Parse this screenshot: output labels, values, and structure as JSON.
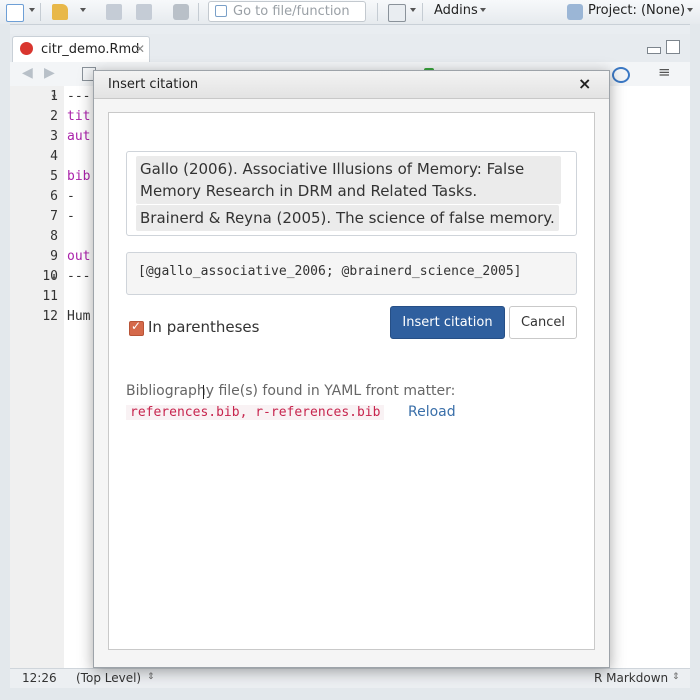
{
  "toolbar": {
    "goto_placeholder": "Go to file/function",
    "addins_label": "Addins",
    "project_label": "Project: (None)"
  },
  "editor": {
    "tab_label": "citr_demo.Rmd",
    "line_numbers": [
      "1",
      "2",
      "3",
      "4",
      "5",
      "6",
      "7",
      "8",
      "9",
      "10",
      "11",
      "12"
    ],
    "code_lines": [
      {
        "text": "---",
        "color": "#333333"
      },
      {
        "text": "tit",
        "color": "#aa22aa"
      },
      {
        "text": "aut",
        "color": "#aa22aa"
      },
      {
        "text": "",
        "color": "#333333"
      },
      {
        "text": "bib",
        "color": "#aa22aa"
      },
      {
        "text": "  -",
        "color": "#333333"
      },
      {
        "text": "  -",
        "color": "#333333"
      },
      {
        "text": "",
        "color": "#333333"
      },
      {
        "text": "out",
        "color": "#aa22aa"
      },
      {
        "text": "---",
        "color": "#333333"
      },
      {
        "text": "",
        "color": "#333333"
      },
      {
        "text": "Hum",
        "color": "#333333"
      }
    ]
  },
  "status": {
    "position": "12:26",
    "scope": "(Top Level)",
    "mode": "R Markdown"
  },
  "modal": {
    "title": "Insert citation",
    "close": "×",
    "selected_references": [
      "Gallo (2006). Associative Illusions of Memory: False Memory Research in DRM and Related Tasks.",
      "Brainerd & Reyna (2005). The science of false memory."
    ],
    "citation_keys": "[@gallo_associative_2006; @brainerd_science_2005]",
    "in_parentheses_label": "In parentheses",
    "in_parentheses_checked": true,
    "insert_button": "Insert citation",
    "cancel_button": "Cancel",
    "bibliography_message": "Bibliography file(s) found in YAML front matter:",
    "bibliography_files": "references.bib, r-references.bib",
    "reload_link": "Reload"
  },
  "colors": {
    "primary_button": "#2f5f9e",
    "checkbox": "#d5694a",
    "code_red": "#c7254e",
    "link": "#3a6fa9"
  }
}
